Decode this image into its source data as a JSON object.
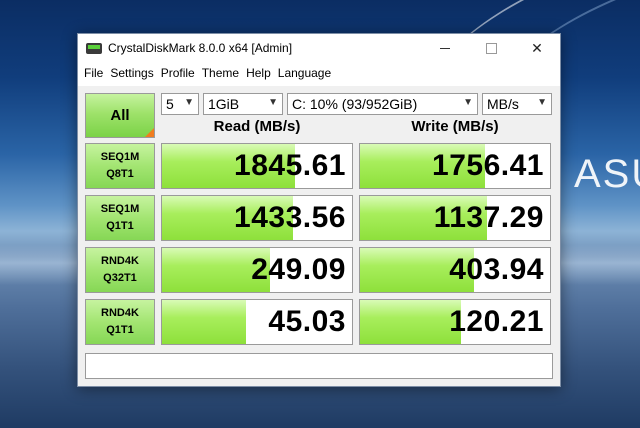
{
  "desktop": {
    "brand_text": "ASU"
  },
  "window": {
    "title": "CrystalDiskMark 8.0.0 x64 [Admin]",
    "controls": {
      "minimize": "—",
      "maximize": "□",
      "close": "✕"
    }
  },
  "menu": {
    "items": [
      "File",
      "Settings",
      "Profile",
      "Theme",
      "Help",
      "Language"
    ]
  },
  "toolbar": {
    "all_label": "All",
    "count_value": "5",
    "size_value": "1GiB",
    "drive_value": "C: 10% (93/952GiB)",
    "unit_value": "MB/s"
  },
  "headers": {
    "read": "Read (MB/s)",
    "write": "Write (MB/s)"
  },
  "rows": [
    {
      "label1": "SEQ1M",
      "label2": "Q8T1",
      "read": "1845.61",
      "write": "1756.41",
      "read_fill": 0.7,
      "write_fill": 0.66
    },
    {
      "label1": "SEQ1M",
      "label2": "Q1T1",
      "read": "1433.56",
      "write": "1137.29",
      "read_fill": 0.69,
      "write_fill": 0.67
    },
    {
      "label1": "RND4K",
      "label2": "Q32T1",
      "read": "249.09",
      "write": "403.94",
      "read_fill": 0.57,
      "write_fill": 0.6
    },
    {
      "label1": "RND4K",
      "label2": "Q1T1",
      "read": "45.03",
      "write": "120.21",
      "read_fill": 0.44,
      "write_fill": 0.53
    }
  ],
  "comment": {
    "value": ""
  }
}
